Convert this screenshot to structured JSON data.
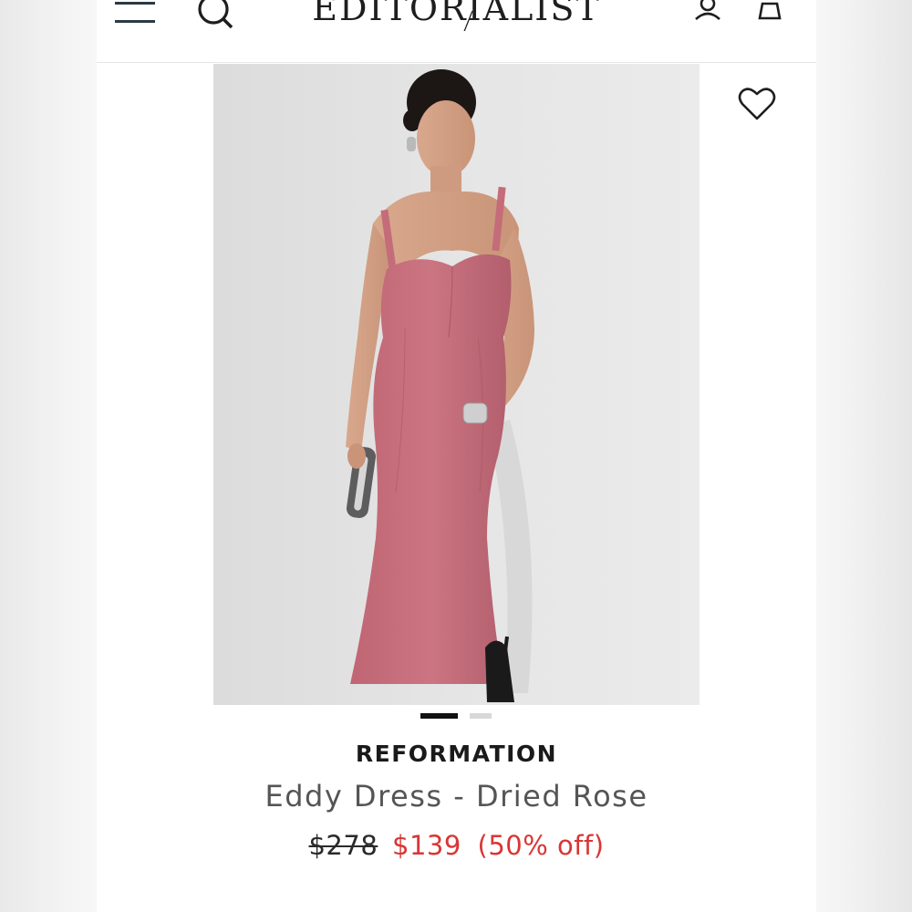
{
  "header": {
    "logo": "EDITORIALIST",
    "icons": [
      "menu-icon",
      "search-icon",
      "account-icon",
      "shopping-bag-icon"
    ]
  },
  "product": {
    "image": "model-pink-midi-dress-photo",
    "wishlist_icon": "heart-icon",
    "carousel": {
      "total": 2,
      "active": 1
    },
    "brand": "REFORMATION",
    "name": "Eddy Dress - Dried Rose",
    "price_original": "$278",
    "price_sale": "$139",
    "discount": "(50% off)"
  },
  "colors": {
    "sale": "#d93636",
    "text_dark": "#1a1a1a",
    "text_muted": "#555555",
    "dress": "#c66f7b"
  }
}
